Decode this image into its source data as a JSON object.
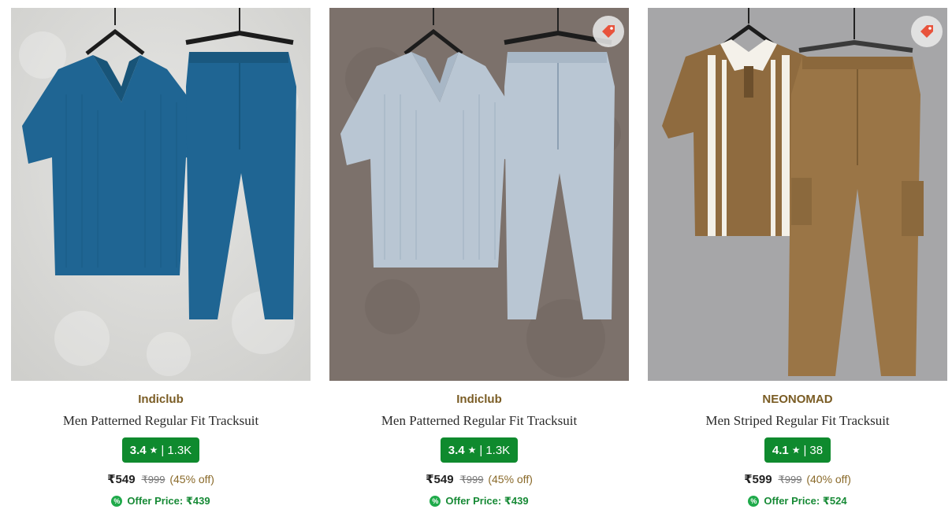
{
  "colors": {
    "brand_text": "#7a5c24",
    "rating_bg": "#0f8a2e",
    "offer_text": "#178a36",
    "offer_icon_bg": "#1faa4a"
  },
  "products": [
    {
      "image_icon": "product-photo",
      "brand": "Indiclub",
      "title": "Men Patterned Regular Fit Tracksuit",
      "rating": "3.4",
      "rating_separator": "|",
      "rating_count": "1.3K",
      "price": "₹549",
      "mrp": "₹999",
      "discount": "(45% off)",
      "offer_icon": "%",
      "offer_text": "Offer Price: ₹439",
      "has_tag_badge": false
    },
    {
      "image_icon": "product-photo",
      "brand": "Indiclub",
      "title": "Men Patterned Regular Fit Tracksuit",
      "rating": "3.4",
      "rating_separator": "|",
      "rating_count": "1.3K",
      "price": "₹549",
      "mrp": "₹999",
      "discount": "(45% off)",
      "offer_icon": "%",
      "offer_text": "Offer Price: ₹439",
      "has_tag_badge": true
    },
    {
      "image_icon": "product-photo",
      "brand": "NEONOMAD",
      "title": "Men Striped Regular Fit Tracksuit",
      "rating": "4.1",
      "rating_separator": "|",
      "rating_count": "38",
      "price": "₹599",
      "mrp": "₹999",
      "discount": "(40% off)",
      "offer_icon": "%",
      "offer_text": "Offer Price: ₹524",
      "has_tag_badge": true
    }
  ]
}
